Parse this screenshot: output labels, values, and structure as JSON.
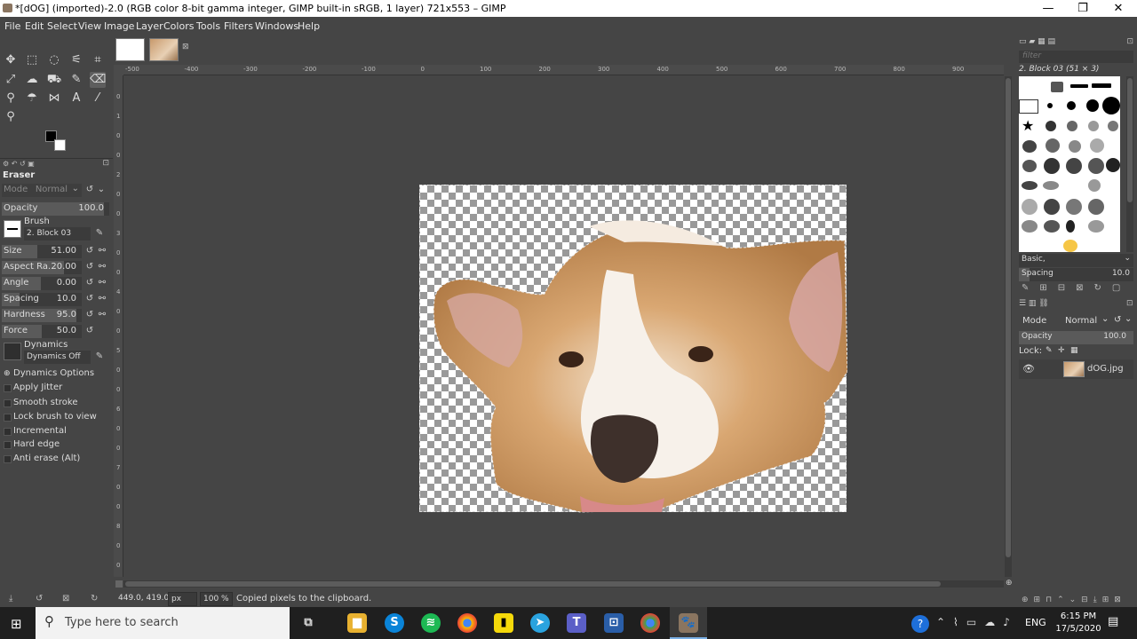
{
  "window": {
    "title": "*[dOG] (imported)-2.0 (RGB color 8-bit gamma integer, GIMP built-in sRGB, 1 layer) 721x553 – GIMP",
    "minimize": "—",
    "maximize": "❐",
    "close": "✕"
  },
  "menu": [
    "File",
    "Edit",
    "Select",
    "View",
    "Image",
    "Layer",
    "Colors",
    "Tools",
    "Filters",
    "Windows",
    "Help"
  ],
  "tool_options": {
    "tool_name": "Eraser",
    "mode_label": "Mode",
    "mode_value": "Normal",
    "opacity_label": "Opacity",
    "opacity_value": "100.0",
    "brush_label": "Brush",
    "brush_value": "2. Block 03",
    "size_label": "Size",
    "size_value": "51.00",
    "aspect_label": "Aspect Ra...",
    "aspect_value": "20.00",
    "angle_label": "Angle",
    "angle_value": "0.00",
    "spacing_label": "Spacing",
    "spacing_value": "10.0",
    "hardness_label": "Hardness",
    "hardness_value": "95.0",
    "force_label": "Force",
    "force_value": "50.0",
    "dynamics_label": "Dynamics",
    "dynamics_value": "Dynamics Off",
    "dynamics_options": "Dynamics Options",
    "apply_jitter": "Apply Jitter",
    "smooth_stroke": "Smooth stroke",
    "lock_brush": "Lock brush to view",
    "incremental": "Incremental",
    "hard_edge": "Hard edge",
    "anti_erase": "Anti erase  (Alt)"
  },
  "ruler": {
    "top": [
      "-500",
      "-400",
      "-300",
      "-200",
      "-100",
      "0",
      "100",
      "200",
      "300",
      "400",
      "500",
      "600",
      "700",
      "800",
      "900"
    ],
    "left": [
      "0",
      "1",
      "0",
      "0",
      "2",
      "0",
      "0",
      "3",
      "0",
      "0",
      "4",
      "0",
      "0",
      "5",
      "0",
      "0",
      "6",
      "0",
      "0",
      "7",
      "0",
      "0",
      "8",
      "0",
      "0"
    ]
  },
  "statusbar": {
    "coords": "449.0, 419.0",
    "unit": "px",
    "zoom": "100 %",
    "message": "Copied pixels to the clipboard."
  },
  "brushes": {
    "filter_placeholder": "filter",
    "current": "2. Block 03 (51 × 3)",
    "preset": "Basic,",
    "spacing_label": "Spacing",
    "spacing_value": "10.0"
  },
  "layers": {
    "mode_label": "Mode",
    "mode_value": "Normal",
    "opacity_label": "Opacity",
    "opacity_value": "100.0",
    "lock_label": "Lock:",
    "layer_name": "dOG.jpg"
  },
  "taskbar": {
    "search_placeholder": "Type here to search",
    "time": "6:15 PM",
    "date": "17/5/2020",
    "lang": "ENG"
  }
}
